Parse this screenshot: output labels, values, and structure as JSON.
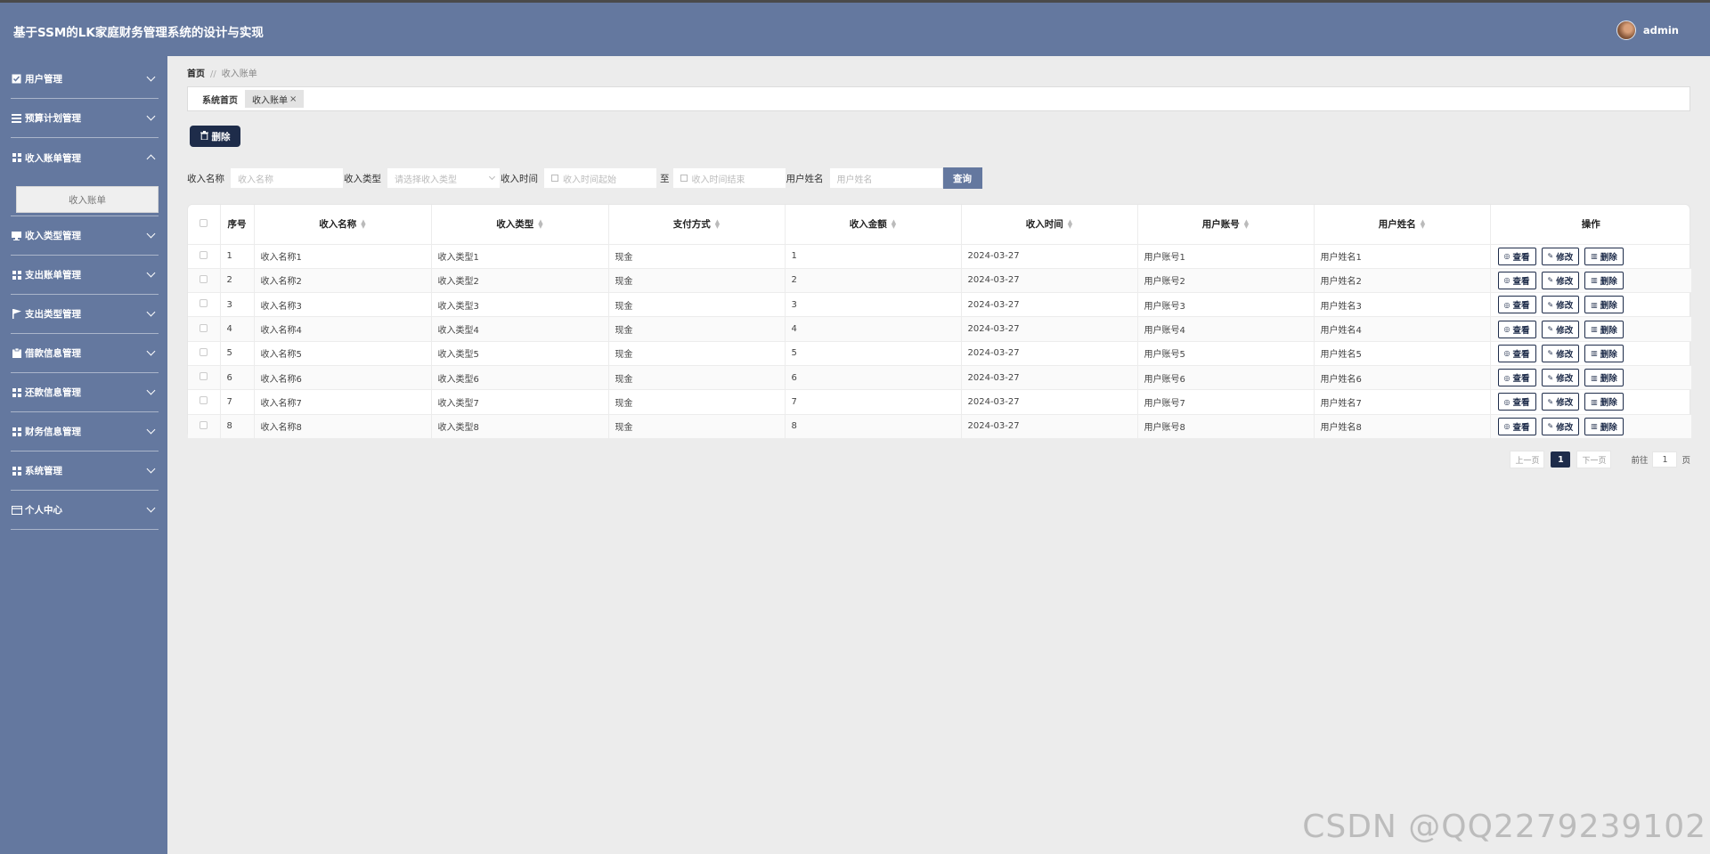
{
  "app": {
    "title": "基于SSM的LK家庭财务管理系统的设计与实现",
    "user_name": "admin"
  },
  "sidebar": {
    "items": [
      {
        "label": "用户管理",
        "icon": "checkbox-icon"
      },
      {
        "label": "预算计划管理",
        "icon": "list-icon"
      },
      {
        "label": "收入账单管理",
        "icon": "grid-icon",
        "expanded": true,
        "submenu": [
          "收入账单"
        ]
      },
      {
        "label": "收入类型管理",
        "icon": "monitor-icon"
      },
      {
        "label": "支出账单管理",
        "icon": "grid-icon"
      },
      {
        "label": "支出类型管理",
        "icon": "flag-icon"
      },
      {
        "label": "借款信息管理",
        "icon": "clipboard-icon"
      },
      {
        "label": "还款信息管理",
        "icon": "grid-icon"
      },
      {
        "label": "财务信息管理",
        "icon": "grid-icon"
      },
      {
        "label": "系统管理",
        "icon": "grid-icon"
      },
      {
        "label": "个人中心",
        "icon": "id-card-icon"
      }
    ]
  },
  "breadcrumb": {
    "home": "首页",
    "sep": "//",
    "current": "收入账单"
  },
  "tabs": [
    {
      "label": "系统首页"
    },
    {
      "label": "收入账单",
      "close": "×"
    }
  ],
  "toolbar": {
    "delete_label": "删除"
  },
  "search": {
    "name_label": "收入名称",
    "name_placeholder": "收入名称",
    "type_label": "收入类型",
    "type_placeholder": "请选择收入类型",
    "time_label": "收入时间",
    "time_start_placeholder": "收入时间起始",
    "time_to": "至",
    "time_end_placeholder": "收入时间结束",
    "username_label": "用户姓名",
    "username_placeholder": "用户姓名",
    "query_label": "查询"
  },
  "table": {
    "columns": [
      "序号",
      "收入名称",
      "收入类型",
      "支付方式",
      "收入金额",
      "收入时间",
      "用户账号",
      "用户姓名",
      "操作"
    ],
    "actions": {
      "view": "查看",
      "edit": "修改",
      "delete": "删除"
    },
    "rows": [
      [
        "1",
        "收入名称1",
        "收入类型1",
        "现金",
        "1",
        "2024-03-27",
        "用户账号1",
        "用户姓名1"
      ],
      [
        "2",
        "收入名称2",
        "收入类型2",
        "现金",
        "2",
        "2024-03-27",
        "用户账号2",
        "用户姓名2"
      ],
      [
        "3",
        "收入名称3",
        "收入类型3",
        "现金",
        "3",
        "2024-03-27",
        "用户账号3",
        "用户姓名3"
      ],
      [
        "4",
        "收入名称4",
        "收入类型4",
        "现金",
        "4",
        "2024-03-27",
        "用户账号4",
        "用户姓名4"
      ],
      [
        "5",
        "收入名称5",
        "收入类型5",
        "现金",
        "5",
        "2024-03-27",
        "用户账号5",
        "用户姓名5"
      ],
      [
        "6",
        "收入名称6",
        "收入类型6",
        "现金",
        "6",
        "2024-03-27",
        "用户账号6",
        "用户姓名6"
      ],
      [
        "7",
        "收入名称7",
        "收入类型7",
        "现金",
        "7",
        "2024-03-27",
        "用户账号7",
        "用户姓名7"
      ],
      [
        "8",
        "收入名称8",
        "收入类型8",
        "现金",
        "8",
        "2024-03-27",
        "用户账号8",
        "用户姓名8"
      ]
    ]
  },
  "pagination": {
    "prev": "上一页",
    "current": "1",
    "next": "下一页",
    "goto": "前往",
    "goto_value": "1",
    "page_unit": "页"
  },
  "watermark": "CSDN @QQ2279239102",
  "colors": {
    "primary": "#64789f",
    "dark": "#1e2c4a",
    "background": "#ececec"
  }
}
